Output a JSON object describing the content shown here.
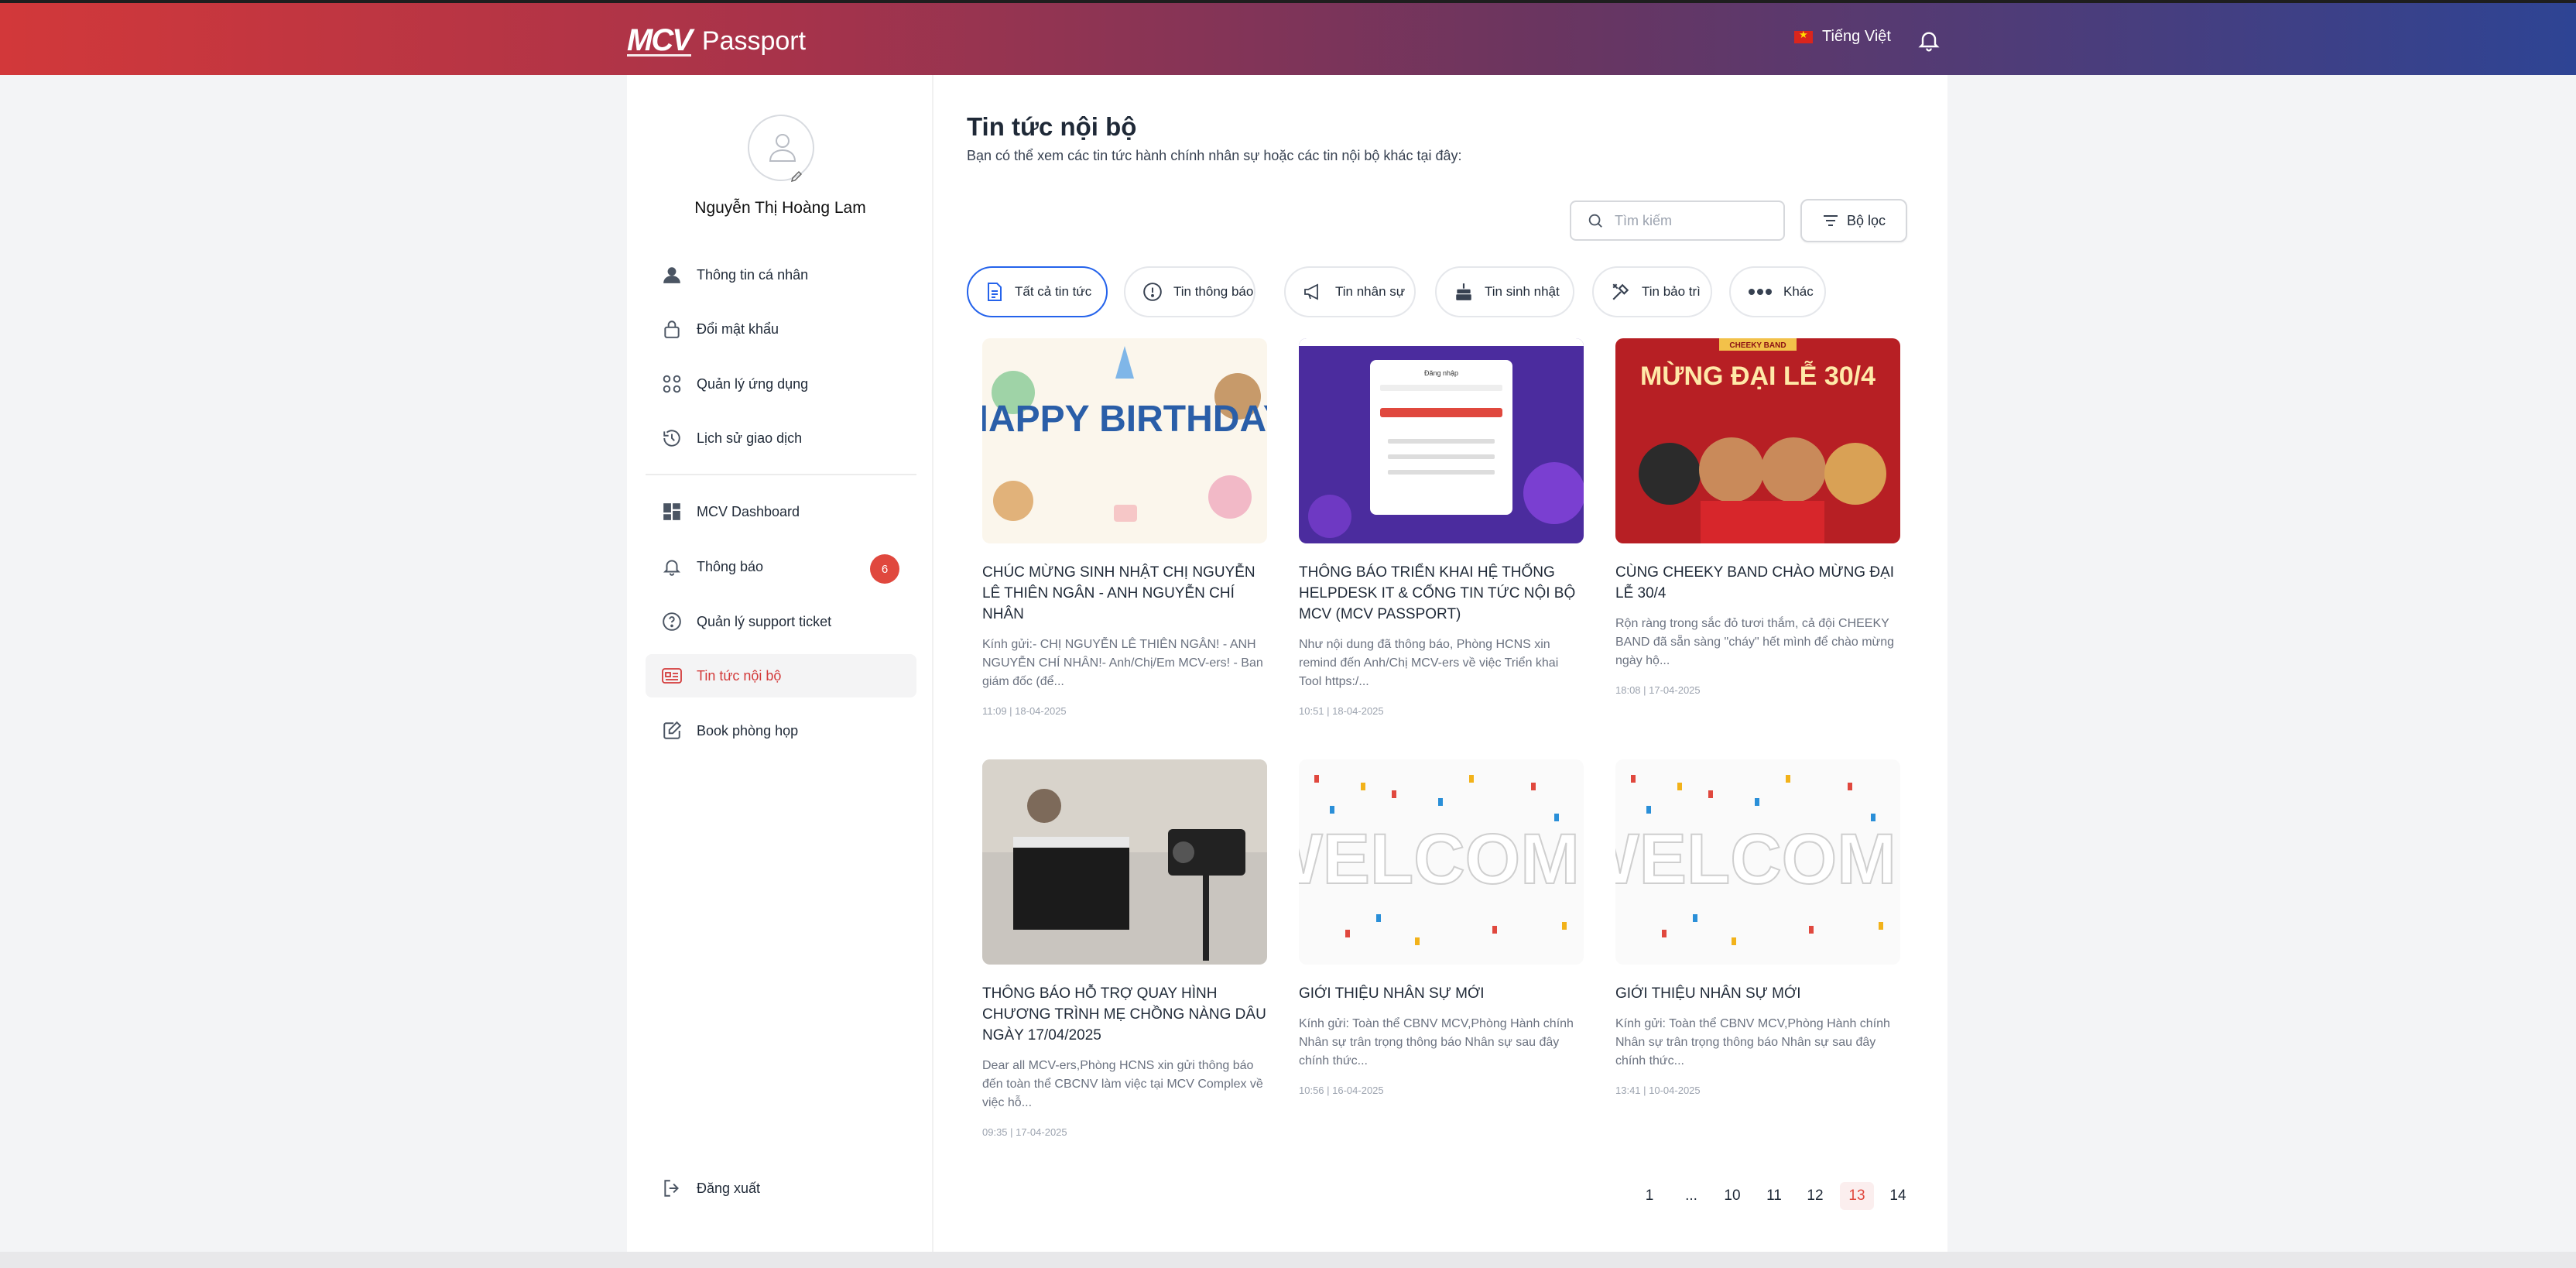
{
  "header": {
    "logo_mark": "MCV",
    "app_name": "Passport",
    "language": "Tiếng Việt"
  },
  "sidebar": {
    "user_name": "Nguyễn Thị Hoàng Lam",
    "items": [
      {
        "label": "Thông tin cá nhân",
        "icon": "user-icon"
      },
      {
        "label": "Đổi mật khẩu",
        "icon": "lock-icon"
      },
      {
        "label": "Quản lý ứng dụng",
        "icon": "apps-icon"
      },
      {
        "label": "Lịch sử giao dịch",
        "icon": "history-icon"
      },
      {
        "label": "MCV Dashboard",
        "icon": "dashboard-icon"
      },
      {
        "label": "Thông báo",
        "icon": "bell-icon",
        "badge": "6"
      },
      {
        "label": "Quản lý support ticket",
        "icon": "help-icon"
      },
      {
        "label": "Tin tức nội bộ",
        "icon": "news-icon",
        "active": true
      },
      {
        "label": "Book phòng họp",
        "icon": "edit-icon"
      }
    ],
    "logout_label": "Đăng xuất"
  },
  "main": {
    "title": "Tin tức nội bộ",
    "subtitle": "Bạn có thể xem các tin tức hành chính nhân sự hoặc các tin nội bộ khác tại đây:",
    "search_placeholder": "Tìm kiếm",
    "filter_label": "Bộ lọc",
    "tabs": [
      {
        "label": "Tất cả tin tức",
        "icon": "document-icon",
        "active": true
      },
      {
        "label": "Tin thông báo",
        "icon": "alert-circle-icon"
      },
      {
        "label": "Tin nhân sự",
        "icon": "megaphone-icon"
      },
      {
        "label": "Tin sinh nhật",
        "icon": "cake-icon"
      },
      {
        "label": "Tin bảo trì",
        "icon": "tools-icon"
      },
      {
        "label": "Khác",
        "icon": "more-dots-icon"
      }
    ],
    "articles": [
      {
        "title": "CHÚC MỪNG SINH NHẬT CHỊ NGUYỄN LÊ THIÊN NGÂN - ANH NGUYỄN CHÍ NHÂN",
        "excerpt": "Kính gửi:- CHỊ NGUYỄN LÊ THIÊN NGÂN! - ANH NGUYỄN CHÍ NHÂN!- Anh/Chị/Em MCV-ers! - Ban giám đốc (để...",
        "date": "11:09 | 18-04-2025",
        "image_text": "HAPPY BIRTHDAY"
      },
      {
        "title": "THÔNG BÁO TRIỂN KHAI HỆ THỐNG HELPDESK IT & CỔNG TIN TỨC NỘI BỘ MCV (MCV PASSPORT)",
        "excerpt": "Như nội dung đã thông báo, Phòng HCNS xin remind đến Anh/Chị MCV-ers về việc Triển khai Tool https:/...",
        "date": "10:51 | 18-04-2025",
        "image_text": "Đăng nhập"
      },
      {
        "title": "CÙNG CHEEKY BAND CHÀO MỪNG ĐẠI LỄ 30/4",
        "excerpt": "Rộn ràng trong sắc đỏ tươi thắm, cả đội CHEEKY BAND đã sẵn sàng \"cháy\" hết mình để chào mừng ngày hộ...",
        "date": "18:08 | 17-04-2025",
        "image_text": "MỪNG ĐẠI LỄ 30/4",
        "image_badge": "CHEEKY BAND"
      },
      {
        "title": "THÔNG BÁO HỖ TRỢ QUAY HÌNH CHƯƠNG TRÌNH MẸ CHỒNG NÀNG DÂU NGÀY 17/04/2025",
        "excerpt": "Dear all MCV-ers,Phòng HCNS xin gửi thông báo đến toàn thể CBCNV làm việc tại MCV Complex về việc hỗ...",
        "date": "09:35 | 17-04-2025",
        "image_text": ""
      },
      {
        "title": "GIỚI THIỆU NHÂN SỰ MỚI",
        "excerpt": "Kính gửi: Toàn thể CBNV MCV,Phòng Hành chính Nhân sự trân trọng thông báo Nhân sự sau đây chính thức...",
        "date": "10:56 | 16-04-2025",
        "image_text": "WELCOME"
      },
      {
        "title": "GIỚI THIỆU NHÂN SỰ MỚI",
        "excerpt": "Kính gửi: Toàn thể CBNV MCV,Phòng Hành chính Nhân sự trân trọng thông báo Nhân sự sau đây chính thức...",
        "date": "13:41 | 10-04-2025",
        "image_text": "WELCOME"
      }
    ],
    "pagination": [
      "1",
      "...",
      "10",
      "11",
      "12",
      "13",
      "14"
    ],
    "current_page": "13"
  },
  "colors": {
    "accent": "#d33a3a",
    "active_tab_border": "#2563eb",
    "badge": "#e0483e"
  }
}
